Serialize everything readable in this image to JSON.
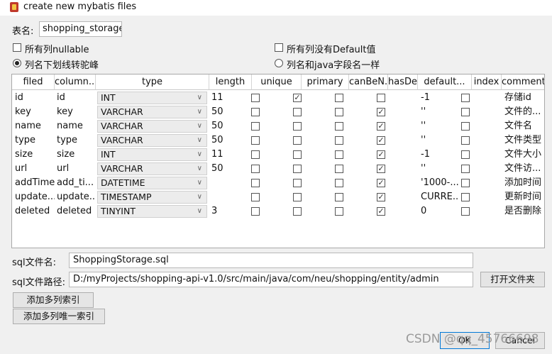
{
  "window": {
    "title": "create new mybatis files"
  },
  "table_name": {
    "label": "表名:",
    "value": "shopping_storage"
  },
  "options": {
    "all_nullable": "所有列nullable",
    "no_default": "所有列没有Default值",
    "camel_case": "列名下划线转驼峰",
    "same_name": "列名和java字段名一样"
  },
  "columns": [
    "filed",
    "column...",
    "type",
    "length",
    "unique",
    "primary",
    "canBeN...",
    "hasDefa...",
    "default...",
    "index",
    "comment"
  ],
  "rows": [
    {
      "filed": "id",
      "column": "id",
      "type": "INT",
      "length": "11",
      "unique": false,
      "primary": true,
      "canBeNull": false,
      "hasDefault": false,
      "default": "-1",
      "index": false,
      "comment": "存储id"
    },
    {
      "filed": "key",
      "column": "key",
      "type": "VARCHAR",
      "length": "50",
      "unique": false,
      "primary": false,
      "canBeNull": false,
      "hasDefault": true,
      "default": "''",
      "index": false,
      "comment": "文件的..."
    },
    {
      "filed": "name",
      "column": "name",
      "type": "VARCHAR",
      "length": "50",
      "unique": false,
      "primary": false,
      "canBeNull": false,
      "hasDefault": true,
      "default": "''",
      "index": false,
      "comment": "文件名"
    },
    {
      "filed": "type",
      "column": "type",
      "type": "VARCHAR",
      "length": "50",
      "unique": false,
      "primary": false,
      "canBeNull": false,
      "hasDefault": true,
      "default": "''",
      "index": false,
      "comment": "文件类型"
    },
    {
      "filed": "size",
      "column": "size",
      "type": "INT",
      "length": "11",
      "unique": false,
      "primary": false,
      "canBeNull": false,
      "hasDefault": true,
      "default": "-1",
      "index": false,
      "comment": "文件大小"
    },
    {
      "filed": "url",
      "column": "url",
      "type": "VARCHAR",
      "length": "50",
      "unique": false,
      "primary": false,
      "canBeNull": false,
      "hasDefault": true,
      "default": "''",
      "index": false,
      "comment": "文件访..."
    },
    {
      "filed": "addTime",
      "column": "add_ti...",
      "type": "DATETIME",
      "length": "",
      "unique": false,
      "primary": false,
      "canBeNull": false,
      "hasDefault": true,
      "default": "'1000-...",
      "index": false,
      "comment": "添加时间"
    },
    {
      "filed": "update...",
      "column": "update...",
      "type": "TIMESTAMP",
      "length": "",
      "unique": false,
      "primary": false,
      "canBeNull": false,
      "hasDefault": true,
      "default": "CURRE...",
      "index": false,
      "comment": "更新时间"
    },
    {
      "filed": "deleted",
      "column": "deleted",
      "type": "TINYINT",
      "length": "3",
      "unique": false,
      "primary": false,
      "canBeNull": false,
      "hasDefault": true,
      "default": "0",
      "index": false,
      "comment": "是否删除"
    }
  ],
  "sql_file": {
    "label": "sql文件名:",
    "value": "ShoppingStorage.sql"
  },
  "sql_path": {
    "label": "sql文件路径:",
    "value": "D:/myProjects/shopping-api-v1.0/src/main/java/com/neu/shopping/entity/admin"
  },
  "buttons": {
    "open_folder": "打开文件夹",
    "add_multi_index": "添加多列索引",
    "add_multi_unique": "添加多列唯一索引",
    "ok": "OK",
    "cancel": "Cancel"
  },
  "watermark": "CSDN @qq_45766698"
}
